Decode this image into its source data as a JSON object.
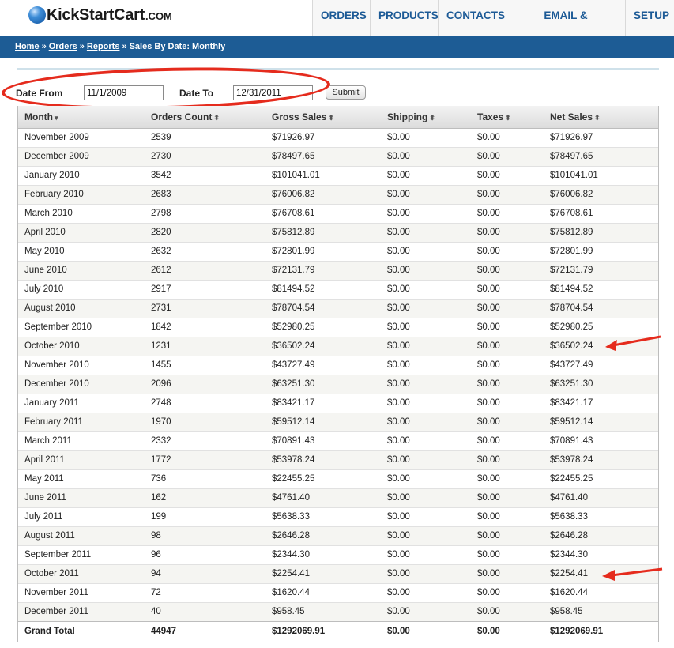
{
  "brand": {
    "logo_k": "K",
    "logo_name": "ickStartCart",
    "logo_com": ".COM"
  },
  "nav": [
    "ORDERS",
    "PRODUCTS",
    "CONTACTS",
    "EMAIL & MARKETING",
    "SETUP"
  ],
  "breadcrumb": {
    "home": "Home",
    "orders": "Orders",
    "reports": "Reports",
    "current": "Sales By Date: Monthly",
    "separator": "»"
  },
  "filter": {
    "from_label": "Date From",
    "from_value": "11/1/2009",
    "to_label": "Date To",
    "to_value": "12/31/2011",
    "submit_label": "Submit"
  },
  "table": {
    "headers": [
      "Month",
      "Orders Count",
      "Gross Sales",
      "Shipping",
      "Taxes",
      "Net Sales"
    ],
    "sort_icons": [
      "▾",
      "⬍",
      "⬍",
      "⬍",
      "⬍",
      "⬍"
    ],
    "rows": [
      [
        "November 2009",
        "2539",
        "$71926.97",
        "$0.00",
        "$0.00",
        "$71926.97"
      ],
      [
        "December 2009",
        "2730",
        "$78497.65",
        "$0.00",
        "$0.00",
        "$78497.65"
      ],
      [
        "January 2010",
        "3542",
        "$101041.01",
        "$0.00",
        "$0.00",
        "$101041.01"
      ],
      [
        "February 2010",
        "2683",
        "$76006.82",
        "$0.00",
        "$0.00",
        "$76006.82"
      ],
      [
        "March 2010",
        "2798",
        "$76708.61",
        "$0.00",
        "$0.00",
        "$76708.61"
      ],
      [
        "April 2010",
        "2820",
        "$75812.89",
        "$0.00",
        "$0.00",
        "$75812.89"
      ],
      [
        "May 2010",
        "2632",
        "$72801.99",
        "$0.00",
        "$0.00",
        "$72801.99"
      ],
      [
        "June 2010",
        "2612",
        "$72131.79",
        "$0.00",
        "$0.00",
        "$72131.79"
      ],
      [
        "July 2010",
        "2917",
        "$81494.52",
        "$0.00",
        "$0.00",
        "$81494.52"
      ],
      [
        "August 2010",
        "2731",
        "$78704.54",
        "$0.00",
        "$0.00",
        "$78704.54"
      ],
      [
        "September 2010",
        "1842",
        "$52980.25",
        "$0.00",
        "$0.00",
        "$52980.25"
      ],
      [
        "October 2010",
        "1231",
        "$36502.24",
        "$0.00",
        "$0.00",
        "$36502.24"
      ],
      [
        "November 2010",
        "1455",
        "$43727.49",
        "$0.00",
        "$0.00",
        "$43727.49"
      ],
      [
        "December 2010",
        "2096",
        "$63251.30",
        "$0.00",
        "$0.00",
        "$63251.30"
      ],
      [
        "January 2011",
        "2748",
        "$83421.17",
        "$0.00",
        "$0.00",
        "$83421.17"
      ],
      [
        "February 2011",
        "1970",
        "$59512.14",
        "$0.00",
        "$0.00",
        "$59512.14"
      ],
      [
        "March 2011",
        "2332",
        "$70891.43",
        "$0.00",
        "$0.00",
        "$70891.43"
      ],
      [
        "April 2011",
        "1772",
        "$53978.24",
        "$0.00",
        "$0.00",
        "$53978.24"
      ],
      [
        "May 2011",
        "736",
        "$22455.25",
        "$0.00",
        "$0.00",
        "$22455.25"
      ],
      [
        "June 2011",
        "162",
        "$4761.40",
        "$0.00",
        "$0.00",
        "$4761.40"
      ],
      [
        "July 2011",
        "199",
        "$5638.33",
        "$0.00",
        "$0.00",
        "$5638.33"
      ],
      [
        "August 2011",
        "98",
        "$2646.28",
        "$0.00",
        "$0.00",
        "$2646.28"
      ],
      [
        "September 2011",
        "96",
        "$2344.30",
        "$0.00",
        "$0.00",
        "$2344.30"
      ],
      [
        "October 2011",
        "94",
        "$2254.41",
        "$0.00",
        "$0.00",
        "$2254.41"
      ],
      [
        "November 2011",
        "72",
        "$1620.44",
        "$0.00",
        "$0.00",
        "$1620.44"
      ],
      [
        "December 2011",
        "40",
        "$958.45",
        "$0.00",
        "$0.00",
        "$958.45"
      ]
    ],
    "totals": [
      "Grand Total",
      "44947",
      "$1292069.91",
      "$0.00",
      "$0.00",
      "$1292069.91"
    ]
  },
  "annotations": {
    "highlight_color": "#e52b1d",
    "arrow_rows": [
      "October 2010",
      "October 2011"
    ]
  },
  "colors": {
    "nav_text": "#1c5a96",
    "breadcrumb_band": "#1d5c95"
  }
}
